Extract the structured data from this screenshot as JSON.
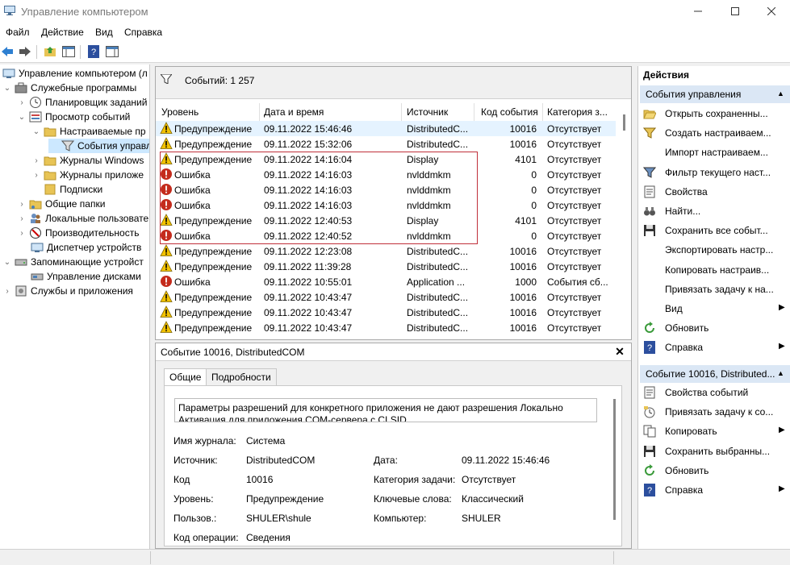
{
  "window": {
    "title": "Управление компьютером"
  },
  "menu": [
    "Файл",
    "Действие",
    "Вид",
    "Справка"
  ],
  "tree": {
    "items": [
      {
        "label": "Управление компьютером (л"
      },
      {
        "label": "Служебные программы"
      },
      {
        "label": "Планировщик заданий"
      },
      {
        "label": "Просмотр событий"
      },
      {
        "label": "Настраиваемые пр"
      },
      {
        "label": "События управл"
      },
      {
        "label": "Журналы Windows"
      },
      {
        "label": "Журналы приложе"
      },
      {
        "label": "Подписки"
      },
      {
        "label": "Общие папки"
      },
      {
        "label": "Локальные пользовате"
      },
      {
        "label": "Производительность"
      },
      {
        "label": "Диспетчер устройств"
      },
      {
        "label": "Запоминающие устройст"
      },
      {
        "label": "Управление дисками"
      },
      {
        "label": "Службы и приложения"
      }
    ]
  },
  "events": {
    "count_label": "Событий: 1 257",
    "columns": [
      "Уровень",
      "Дата и время",
      "Источник",
      "Код события",
      "Категория з..."
    ],
    "rows": [
      {
        "level": "Предупреждение",
        "datetime": "09.11.2022 15:46:46",
        "source": "DistributedC...",
        "id": "10016",
        "category": "Отсутствует",
        "type": "warning"
      },
      {
        "level": "Предупреждение",
        "datetime": "09.11.2022 15:32:06",
        "source": "DistributedC...",
        "id": "10016",
        "category": "Отсутствует",
        "type": "warning"
      },
      {
        "level": "Предупреждение",
        "datetime": "09.11.2022 14:16:04",
        "source": "Display",
        "id": "4101",
        "category": "Отсутствует",
        "type": "warning"
      },
      {
        "level": "Ошибка",
        "datetime": "09.11.2022 14:16:03",
        "source": "nvlddmkm",
        "id": "0",
        "category": "Отсутствует",
        "type": "error"
      },
      {
        "level": "Ошибка",
        "datetime": "09.11.2022 14:16:03",
        "source": "nvlddmkm",
        "id": "0",
        "category": "Отсутствует",
        "type": "error"
      },
      {
        "level": "Ошибка",
        "datetime": "09.11.2022 14:16:03",
        "source": "nvlddmkm",
        "id": "0",
        "category": "Отсутствует",
        "type": "error"
      },
      {
        "level": "Предупреждение",
        "datetime": "09.11.2022 12:40:53",
        "source": "Display",
        "id": "4101",
        "category": "Отсутствует",
        "type": "warning"
      },
      {
        "level": "Ошибка",
        "datetime": "09.11.2022 12:40:52",
        "source": "nvlddmkm",
        "id": "0",
        "category": "Отсутствует",
        "type": "error"
      },
      {
        "level": "Предупреждение",
        "datetime": "09.11.2022 12:23:08",
        "source": "DistributedC...",
        "id": "10016",
        "category": "Отсутствует",
        "type": "warning"
      },
      {
        "level": "Предупреждение",
        "datetime": "09.11.2022 11:39:28",
        "source": "DistributedC...",
        "id": "10016",
        "category": "Отсутствует",
        "type": "warning"
      },
      {
        "level": "Ошибка",
        "datetime": "09.11.2022 10:55:01",
        "source": "Application ...",
        "id": "1000",
        "category": "События сб...",
        "type": "error"
      },
      {
        "level": "Предупреждение",
        "datetime": "09.11.2022 10:43:47",
        "source": "DistributedC...",
        "id": "10016",
        "category": "Отсутствует",
        "type": "warning"
      },
      {
        "level": "Предупреждение",
        "datetime": "09.11.2022 10:43:47",
        "source": "DistributedC...",
        "id": "10016",
        "category": "Отсутствует",
        "type": "warning"
      },
      {
        "level": "Предупреждение",
        "datetime": "09.11.2022 10:43:47",
        "source": "DistributedC...",
        "id": "10016",
        "category": "Отсутствует",
        "type": "warning"
      }
    ]
  },
  "detail": {
    "title": "Событие 10016, DistributedCOM",
    "tabs": [
      "Общие",
      "Подробности"
    ],
    "message": "Параметры разрешений для конкретного приложения не дают разрешения Локально Активация для приложения COM-сервера с CLSID",
    "fields": {
      "log_name_label": "Имя журнала:",
      "log_name": "Система",
      "source_label": "Источник:",
      "source": "DistributedCOM",
      "date_label": "Дата:",
      "date": "09.11.2022 15:46:46",
      "code_label": "Код",
      "code": "10016",
      "task_label": "Категория задачи:",
      "task": "Отсутствует",
      "level_label": "Уровень:",
      "level": "Предупреждение",
      "keywords_label": "Ключевые слова:",
      "keywords": "Классический",
      "user_label": "Пользов.:",
      "user": "SHULER\\shule",
      "computer_label": "Компьютер:",
      "computer": "SHULER",
      "opcode_label": "Код операции:",
      "opcode": "Сведения"
    }
  },
  "actions": {
    "header": "Действия",
    "section1": "События управления",
    "section1_items": [
      {
        "label": "Открыть сохраненны...",
        "icon": "folder-open-icon"
      },
      {
        "label": "Создать настраиваем...",
        "icon": "funnel-icon"
      },
      {
        "label": "Импорт настраиваем...",
        "icon": "none"
      },
      {
        "label": "Фильтр текущего наст...",
        "icon": "filter-icon"
      },
      {
        "label": "Свойства",
        "icon": "properties-icon"
      },
      {
        "label": "Найти...",
        "icon": "binoculars-icon"
      },
      {
        "label": "Сохранить все событ...",
        "icon": "save-icon"
      },
      {
        "label": "Экспортировать настр...",
        "icon": "none"
      },
      {
        "label": "Копировать настраив...",
        "icon": "none"
      },
      {
        "label": "Привязать задачу к на...",
        "icon": "none"
      },
      {
        "label": "Вид",
        "icon": "none",
        "submenu": true
      },
      {
        "label": "Обновить",
        "icon": "refresh-icon"
      },
      {
        "label": "Справка",
        "icon": "help-icon",
        "submenu": true
      }
    ],
    "section2": "Событие 10016, Distributed...",
    "section2_items": [
      {
        "label": "Свойства событий",
        "icon": "properties-icon"
      },
      {
        "label": "Привязать задачу к со...",
        "icon": "task-icon"
      },
      {
        "label": "Копировать",
        "icon": "copy-icon",
        "submenu": true
      },
      {
        "label": "Сохранить выбранны...",
        "icon": "save-icon"
      },
      {
        "label": "Обновить",
        "icon": "refresh-icon"
      },
      {
        "label": "Справка",
        "icon": "help-icon",
        "submenu": true
      }
    ]
  },
  "colors": {
    "selection": "#cce8ff",
    "section_header": "#dbe7f5",
    "highlight_border": "#c0303a",
    "warning": "#f2c200",
    "error": "#c42b1c"
  }
}
